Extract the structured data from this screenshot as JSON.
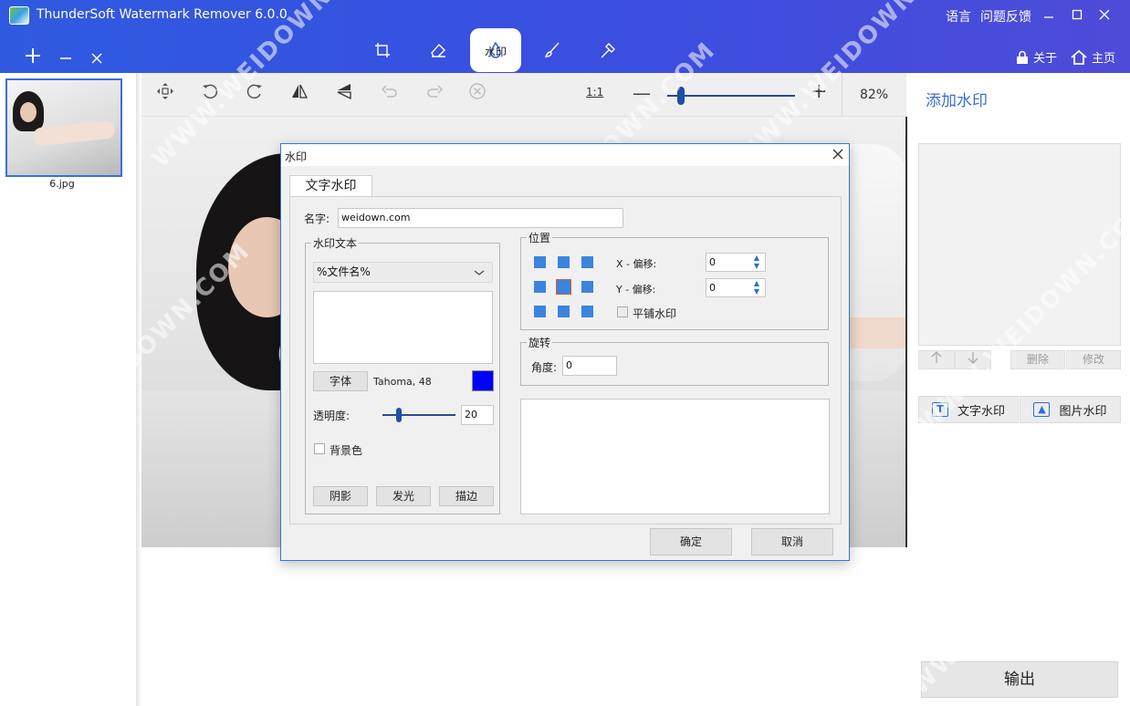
{
  "app": {
    "title": "ThunderSoft Watermark Remover 6.0.0",
    "language_label": "语言",
    "feedback_label": "问题反馈",
    "about_label": "关于",
    "home_label": "主页"
  },
  "mode_tabs": [
    {
      "icon": "crop-icon",
      "label": ""
    },
    {
      "icon": "eraser-icon",
      "label": ""
    },
    {
      "icon": "drop-icon",
      "label": "水印",
      "active": true
    },
    {
      "icon": "brush-icon",
      "label": ""
    },
    {
      "icon": "magic-wand-icon",
      "label": ""
    }
  ],
  "file_list": {
    "items": [
      {
        "name": "6.jpg"
      }
    ]
  },
  "toolbar": {
    "zoom_reset_label": "1:1",
    "zoom_level": 82,
    "zoom_value": "82%"
  },
  "right_panel": {
    "title": "添加水印",
    "delete_label": "删除",
    "modify_label": "修改",
    "text_watermark_label": "文字水印",
    "image_watermark_label": "图片水印",
    "export_label": "输出"
  },
  "dialog": {
    "title": "水印",
    "tab_label": "文字水印",
    "name_label": "名字:",
    "name_value": "weidown.com",
    "text_group_title": "水印文本",
    "text_select_value": "%文件名%",
    "font_button_label": "字体",
    "font_info": "Tahoma, 48",
    "font_color": "#0000ff",
    "opacity_label": "透明度:",
    "opacity_value": "20",
    "background_label": "背景色",
    "shadow_label": "阴影",
    "glow_label": "发光",
    "stroke_label": "描边",
    "position_group_title": "位置",
    "x_offset_label": "X - 偏移:",
    "x_offset_value": "0",
    "y_offset_label": "Y - 偏移:",
    "y_offset_value": "0",
    "tile_label": "平铺水印",
    "rotate_group_title": "旋转",
    "angle_label": "角度:",
    "angle_value": "0",
    "ok_label": "确定",
    "cancel_label": "取消"
  },
  "overlay_watermark": "WWW.WEIDOWN.COM",
  "colors": {
    "header": "#3a4ee0",
    "accent": "#3a6fcf",
    "dialog_border": "#2a7ad8",
    "position_dot": "#3a84de"
  }
}
